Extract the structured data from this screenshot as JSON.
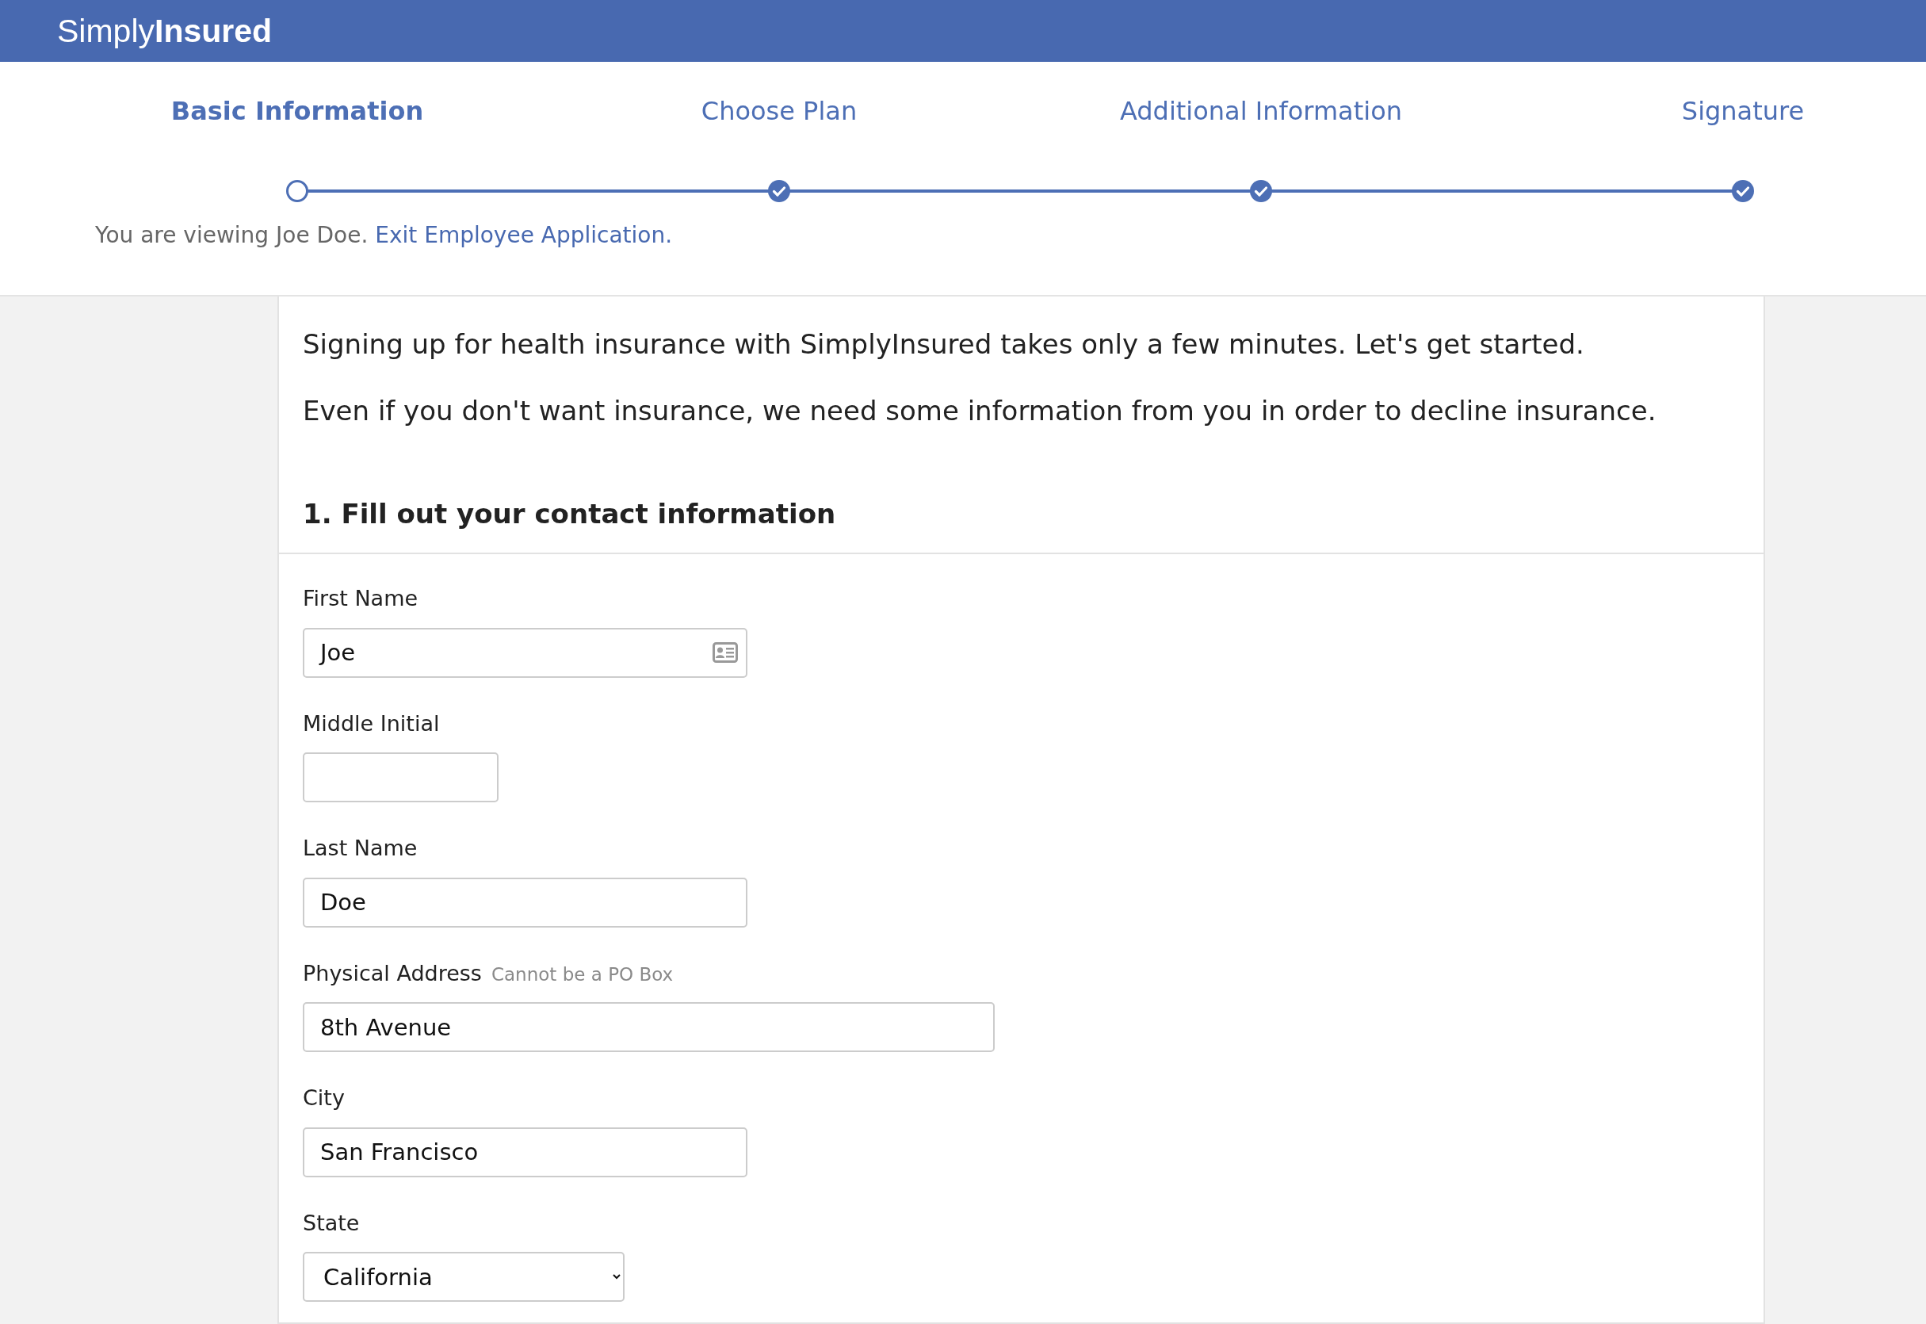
{
  "brand": {
    "light": "Simply",
    "bold": "Insured"
  },
  "steps": [
    {
      "label": "Basic Information",
      "selected": true,
      "checked": false
    },
    {
      "label": "Choose Plan",
      "selected": false,
      "checked": true
    },
    {
      "label": "Additional Information",
      "selected": false,
      "checked": true
    },
    {
      "label": "Signature",
      "selected": false,
      "checked": true
    }
  ],
  "viewing": {
    "text": "You are viewing Joe Doe.",
    "link": "Exit Employee Application."
  },
  "intro": [
    "Signing up for health insurance with SimplyInsured takes only a few minutes. Let's get started.",
    "Even if you don't want insurance, we need some information from you in order to decline insurance."
  ],
  "section_title": "1. Fill out your contact information",
  "fields": [
    {
      "kind": "contact",
      "label": "First Name",
      "value": "Joe"
    },
    {
      "kind": "text",
      "label": "Middle Initial"
    },
    {
      "kind": "text",
      "label": "Last Name",
      "value": "Doe"
    },
    {
      "kind": "text",
      "label": "Physical Address",
      "hint": "Cannot be a PO Box",
      "value": "8th Avenue"
    },
    {
      "kind": "text",
      "label": "City",
      "value": "San Francisco"
    },
    {
      "kind": "select",
      "label": "State",
      "value": "California"
    }
  ]
}
